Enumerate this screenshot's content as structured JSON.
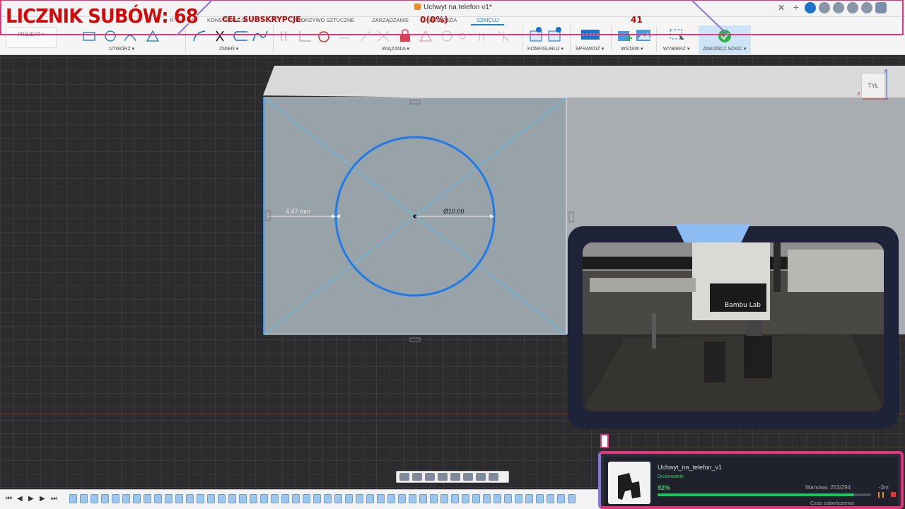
{
  "window": {
    "title": "Uchwyt na telefon v1*"
  },
  "ribbon": {
    "tabs": [
      {
        "label": "RYTA"
      },
      {
        "label": "KONSTRUKCJA"
      },
      {
        "label": "TWORZYWO SZTUCZNE"
      },
      {
        "label": "ZARZĄDZANIE"
      },
      {
        "label": "NARZĘDZIA"
      },
      {
        "label": "SZKICUJ"
      }
    ],
    "projekt_label": "PROJEKT",
    "groups": {
      "create": "UTWÓRZ",
      "modify": "ZMIEŃ",
      "constraints": "WIĄZANIA",
      "configure": "KONFIGURUJ",
      "inspect": "SPRAWDŹ",
      "insert": "WSTAW",
      "select": "WYBIERZ",
      "finish": "ZAKOŃCZ SZKIC"
    }
  },
  "viewport": {
    "dimension_width": "4.47 mm",
    "dimension_diameter": "Ø10.00",
    "viewcube_label": "TYŁ",
    "axis_z": "Z",
    "axis_x": "X"
  },
  "overlay": {
    "sub_counter": "LICZNIK SUBÓW: 68",
    "goal_label": "CEL: SUBSKRYPCJE",
    "goal_progress": "0(0%)",
    "goal_target": "41"
  },
  "camera": {
    "brand": "Bambu Lab"
  },
  "print_job": {
    "name": "Uchwyt_na_telefon_v1",
    "status": "Drukowanie",
    "percent_text": "92%",
    "progress": 0.92,
    "layer": "Warstwa: 253/294",
    "remaining": "-3m",
    "end_label": "Czas zakończenia:"
  },
  "colors": {
    "accent": "#1a7fc9",
    "overlay_pink": "#e0367a",
    "overlay_red": "#d10b0b",
    "progress_green": "#22c55e"
  }
}
